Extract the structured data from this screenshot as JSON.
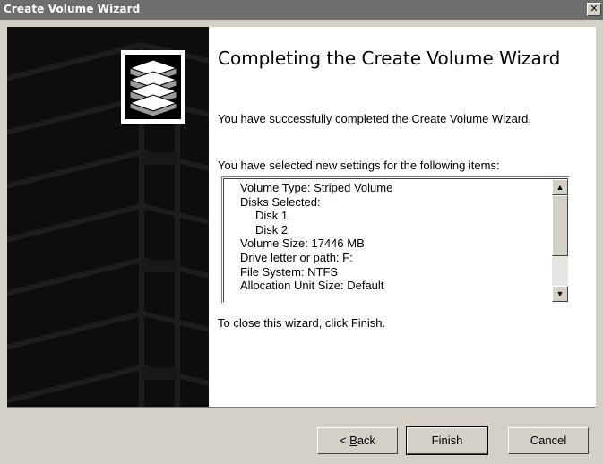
{
  "window": {
    "title": "Create Volume Wizard",
    "close_glyph": "✕"
  },
  "content": {
    "heading": "Completing the Create Volume Wizard",
    "success_text": "You have successfully completed the Create Volume Wizard.",
    "settings_intro": "You have selected new settings for the following items:",
    "settings_lines": [
      "Volume Type: Striped Volume",
      "Disks Selected:",
      "Disk 1",
      "Disk 2",
      "Volume Size: 17446 MB",
      "Drive letter or path: F:",
      "File System: NTFS",
      "Allocation Unit Size: Default"
    ],
    "close_hint": "To close this wizard, click Finish."
  },
  "buttons": {
    "back_prefix": "< ",
    "back_mnemonic": "B",
    "back_rest": "ack",
    "finish": "Finish",
    "cancel": "Cancel"
  },
  "icons": {
    "close": "close-icon",
    "banner": "disk-stack-icon",
    "scroll_up": "scroll-up-arrow-icon",
    "scroll_down": "scroll-down-arrow-icon"
  }
}
